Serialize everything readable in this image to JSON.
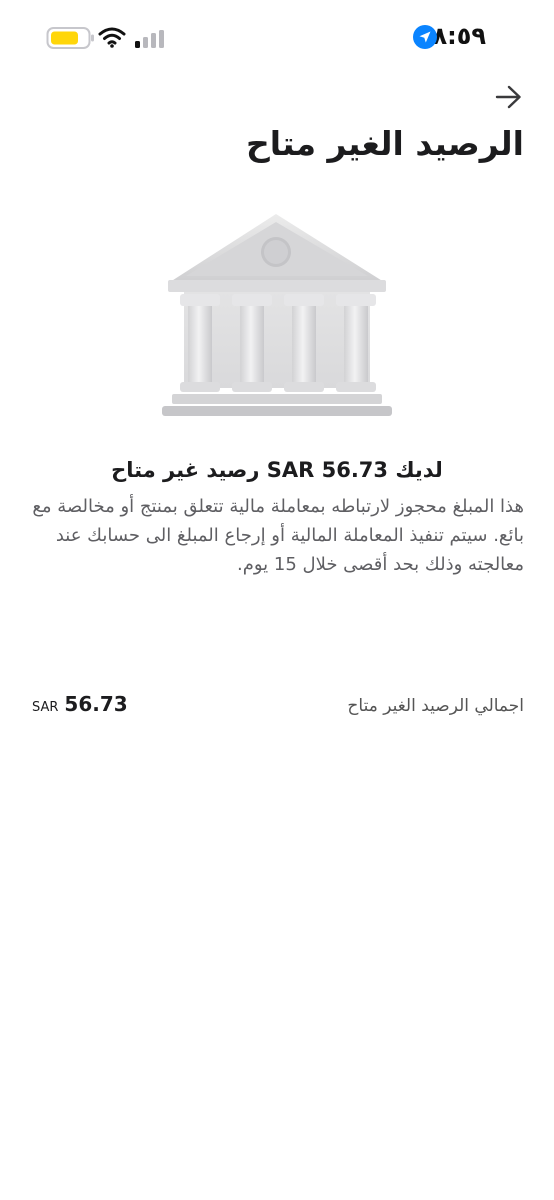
{
  "status_bar": {
    "time": "٨:٥٩",
    "icons": [
      "location-arrow-icon",
      "battery-icon",
      "wifi-icon",
      "signal-icon"
    ],
    "battery_color": "#FFD60A",
    "location_color": "#0A84FF"
  },
  "header": {
    "back_icon": "arrow-right-icon",
    "title": "الرصيد الغير متاح"
  },
  "illustration": {
    "icon": "bank-building-icon"
  },
  "notice": {
    "headline": "لديك SAR 56.73 رصيد غير متاح",
    "body": "هذا المبلغ محجوز لارتباطه بمعاملة مالية تتعلق بمنتج أو مخالصة مع بائع. سيتم تنفيذ المعاملة المالية أو إرجاع المبلغ الى حسابك عند معالجته وذلك بحد أقصى خلال 15 يوم."
  },
  "summary": {
    "label": "اجمالي الرصيد الغير متاح",
    "currency": "SAR",
    "amount": "56.73"
  }
}
